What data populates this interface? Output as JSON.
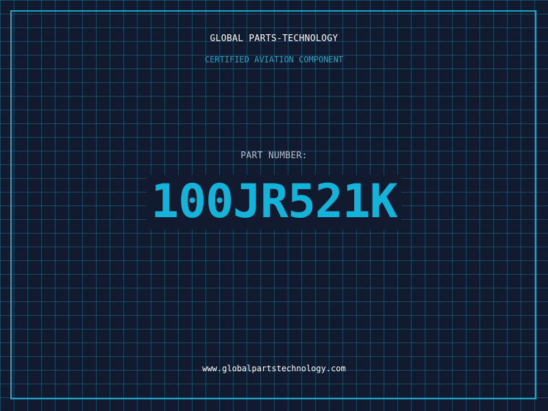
{
  "brand": {
    "name": "GLOBAL PARTS-TECHNOLOGY",
    "tagline": "CERTIFIED AVIATION COMPONENT"
  },
  "part": {
    "label": "PART NUMBER:",
    "number": "100JR521K"
  },
  "footer": {
    "website": "www.globalpartstechnology.com"
  },
  "colors": {
    "background": "#111a2e",
    "grid": "#236e8c",
    "accent": "#1fa6c9",
    "part_number": "#14b4da",
    "text": "#ffffff"
  }
}
